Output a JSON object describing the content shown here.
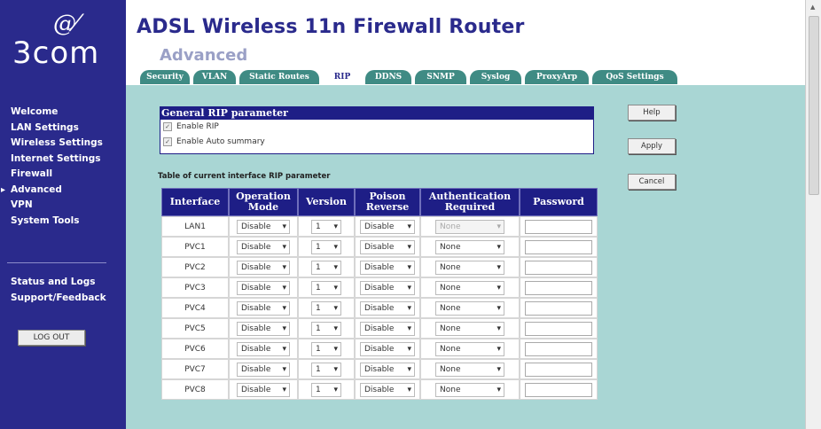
{
  "brand": {
    "mark": "@⁄",
    "name": "3com"
  },
  "header": {
    "title": "ADSL Wireless 11n Firewall Router",
    "subtitle": "Advanced"
  },
  "tabs": [
    {
      "label": "Security",
      "active": false
    },
    {
      "label": "VLAN",
      "active": false
    },
    {
      "label": "Static Routes",
      "active": false
    },
    {
      "label": "RIP",
      "active": true
    },
    {
      "label": "DDNS",
      "active": false
    },
    {
      "label": "SNMP",
      "active": false
    },
    {
      "label": "Syslog",
      "active": false
    },
    {
      "label": "ProxyArp",
      "active": false
    },
    {
      "label": "QoS Settings",
      "active": false
    }
  ],
  "sidebar": {
    "items": [
      {
        "label": "Welcome"
      },
      {
        "label": "LAN Settings"
      },
      {
        "label": "Wireless Settings"
      },
      {
        "label": "Internet Settings"
      },
      {
        "label": "Firewall"
      },
      {
        "label": "Advanced"
      },
      {
        "label": "VPN"
      },
      {
        "label": "System Tools"
      }
    ],
    "items2": [
      {
        "label": "Status and Logs"
      },
      {
        "label": "Support/Feedback"
      }
    ],
    "logout_label": "LOG OUT"
  },
  "general": {
    "header": "General RIP parameter",
    "enable_rip": {
      "label": "Enable RIP",
      "checked": true
    },
    "auto_summary": {
      "label": "Enable Auto summary",
      "checked": true
    }
  },
  "table_label": "Table of current interface RIP parameter",
  "table": {
    "headers": [
      "Interface",
      "Operation Mode",
      "Version",
      "Poison Reverse",
      "Authentication Required",
      "Password"
    ],
    "rows": [
      {
        "iface": "LAN1",
        "mode": "Disable",
        "version": "1",
        "poison": "Disable",
        "auth": "None",
        "auth_disabled": true
      },
      {
        "iface": "PVC1",
        "mode": "Disable",
        "version": "1",
        "poison": "Disable",
        "auth": "None",
        "auth_disabled": false
      },
      {
        "iface": "PVC2",
        "mode": "Disable",
        "version": "1",
        "poison": "Disable",
        "auth": "None",
        "auth_disabled": false
      },
      {
        "iface": "PVC3",
        "mode": "Disable",
        "version": "1",
        "poison": "Disable",
        "auth": "None",
        "auth_disabled": false
      },
      {
        "iface": "PVC4",
        "mode": "Disable",
        "version": "1",
        "poison": "Disable",
        "auth": "None",
        "auth_disabled": false
      },
      {
        "iface": "PVC5",
        "mode": "Disable",
        "version": "1",
        "poison": "Disable",
        "auth": "None",
        "auth_disabled": false
      },
      {
        "iface": "PVC6",
        "mode": "Disable",
        "version": "1",
        "poison": "Disable",
        "auth": "None",
        "auth_disabled": false
      },
      {
        "iface": "PVC7",
        "mode": "Disable",
        "version": "1",
        "poison": "Disable",
        "auth": "None",
        "auth_disabled": false
      },
      {
        "iface": "PVC8",
        "mode": "Disable",
        "version": "1",
        "poison": "Disable",
        "auth": "None",
        "auth_disabled": false
      }
    ]
  },
  "buttons": {
    "help": "Help",
    "apply": "Apply",
    "cancel": "Cancel"
  },
  "colors": {
    "sidebar": "#2a2a8c",
    "main": "#a9d6d4",
    "tab": "#3f8b84",
    "header_blue": "#1e1e86"
  }
}
